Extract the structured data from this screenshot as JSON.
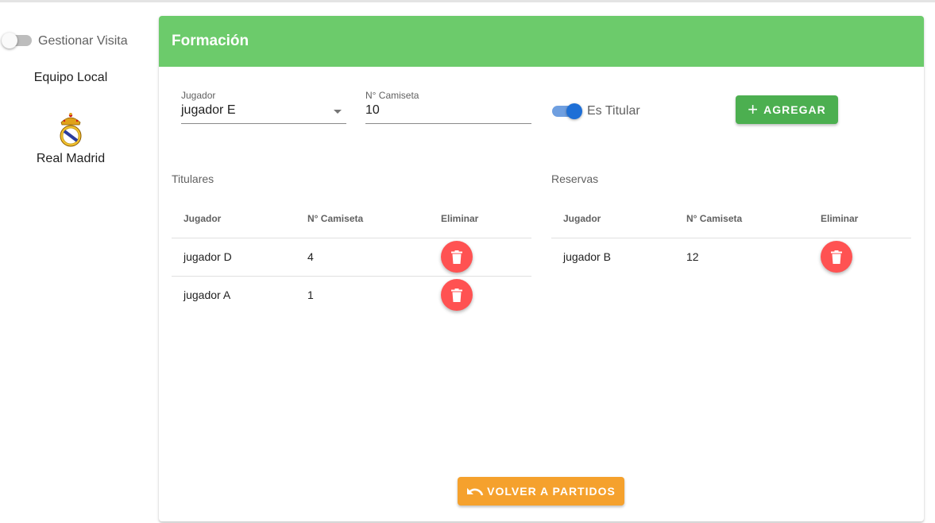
{
  "sidebar": {
    "visit_toggle_label": "Gestionar Visita",
    "team_heading": "Equipo Local",
    "team_name": "Real Madrid",
    "team_logo_icon": "real-madrid-crest-icon"
  },
  "card": {
    "title": "Formación",
    "header_color": "#6ccb6b",
    "form": {
      "player_label": "Jugador",
      "player_value": "jugador E",
      "shirt_label": "N° Camiseta",
      "shirt_value": "10",
      "starter_label": "Es Titular",
      "starter_checked": true,
      "add_button": "AGREGAR"
    },
    "starters": {
      "title": "Titulares",
      "headers": [
        "Jugador",
        "N° Camiseta",
        "Eliminar"
      ],
      "rows": [
        {
          "player": "jugador D",
          "shirt": "4"
        },
        {
          "player": "jugador A",
          "shirt": "1"
        }
      ]
    },
    "reserves": {
      "title": "Reservas",
      "headers": [
        "Jugador",
        "N° Camiseta",
        "Eliminar"
      ],
      "rows": [
        {
          "player": "jugador B",
          "shirt": "12"
        }
      ]
    },
    "back_button": "VOLVER A PARTIDOS"
  },
  "colors": {
    "add_button": "#4caf50",
    "delete_button": "#ff5252",
    "back_button": "#f5a12d",
    "toggle_on": "#1e6fd6"
  }
}
